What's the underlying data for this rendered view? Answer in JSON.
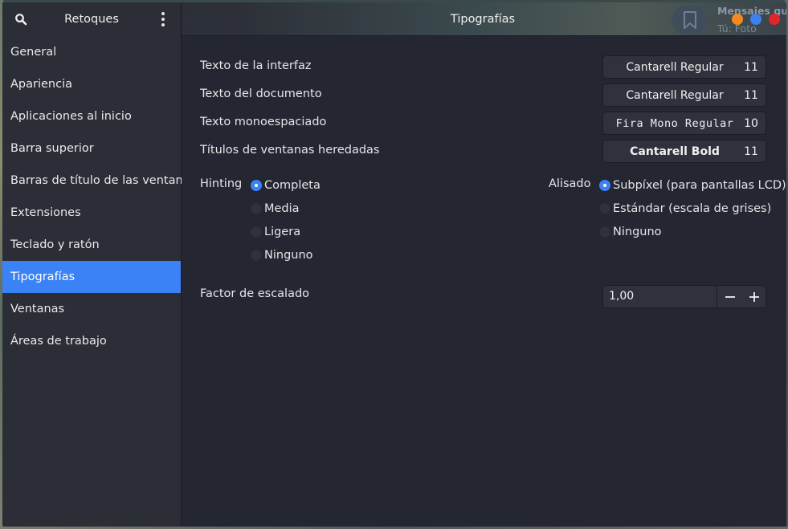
{
  "header": {
    "app_name": "Retoques",
    "title": "Tipografías",
    "search_icon": "search-icon",
    "menu_icon": "vertical-dots-icon"
  },
  "background_notification": {
    "title": "Mensajes gu",
    "subtitle": "Tú: Foto"
  },
  "window_controls": {
    "minimize_color": "#f5891c",
    "maximize_color": "#3b82f0",
    "close_color": "#e0262a"
  },
  "sidebar": {
    "items": [
      {
        "label": "General"
      },
      {
        "label": "Apariencia"
      },
      {
        "label": "Aplicaciones al inicio"
      },
      {
        "label": "Barra superior"
      },
      {
        "label": "Barras de título de las ventanas"
      },
      {
        "label": "Extensiones"
      },
      {
        "label": "Teclado y ratón"
      },
      {
        "label": "Tipografías"
      },
      {
        "label": "Ventanas"
      },
      {
        "label": "Áreas de trabajo"
      }
    ],
    "active": "Tipografías",
    "accent": "#3b82f6"
  },
  "fonts": {
    "interface": {
      "label": "Texto de la interfaz",
      "font": "Cantarell Regular",
      "size": "11"
    },
    "document": {
      "label": "Texto del documento",
      "font": "Cantarell Regular",
      "size": "11"
    },
    "monospace": {
      "label": "Texto monoespaciado",
      "font": "Fira Mono Regular",
      "size": "10"
    },
    "legacy_titles": {
      "label": "Títulos de ventanas heredadas",
      "font": "Cantarell Bold",
      "size": "11"
    }
  },
  "hinting": {
    "label": "Hinting",
    "options": [
      "Completa",
      "Media",
      "Ligera",
      "Ninguno"
    ],
    "selected": "Completa"
  },
  "antialiasing": {
    "label": "Alisado",
    "options": [
      "Subpíxel (para pantallas LCD)",
      "Estándar (escala de grises)",
      "Ninguno"
    ],
    "selected": "Subpíxel (para pantallas LCD)"
  },
  "scaling": {
    "label": "Factor de escalado",
    "value": "1,00",
    "minus_icon": "minus-icon",
    "plus_icon": "plus-icon"
  }
}
